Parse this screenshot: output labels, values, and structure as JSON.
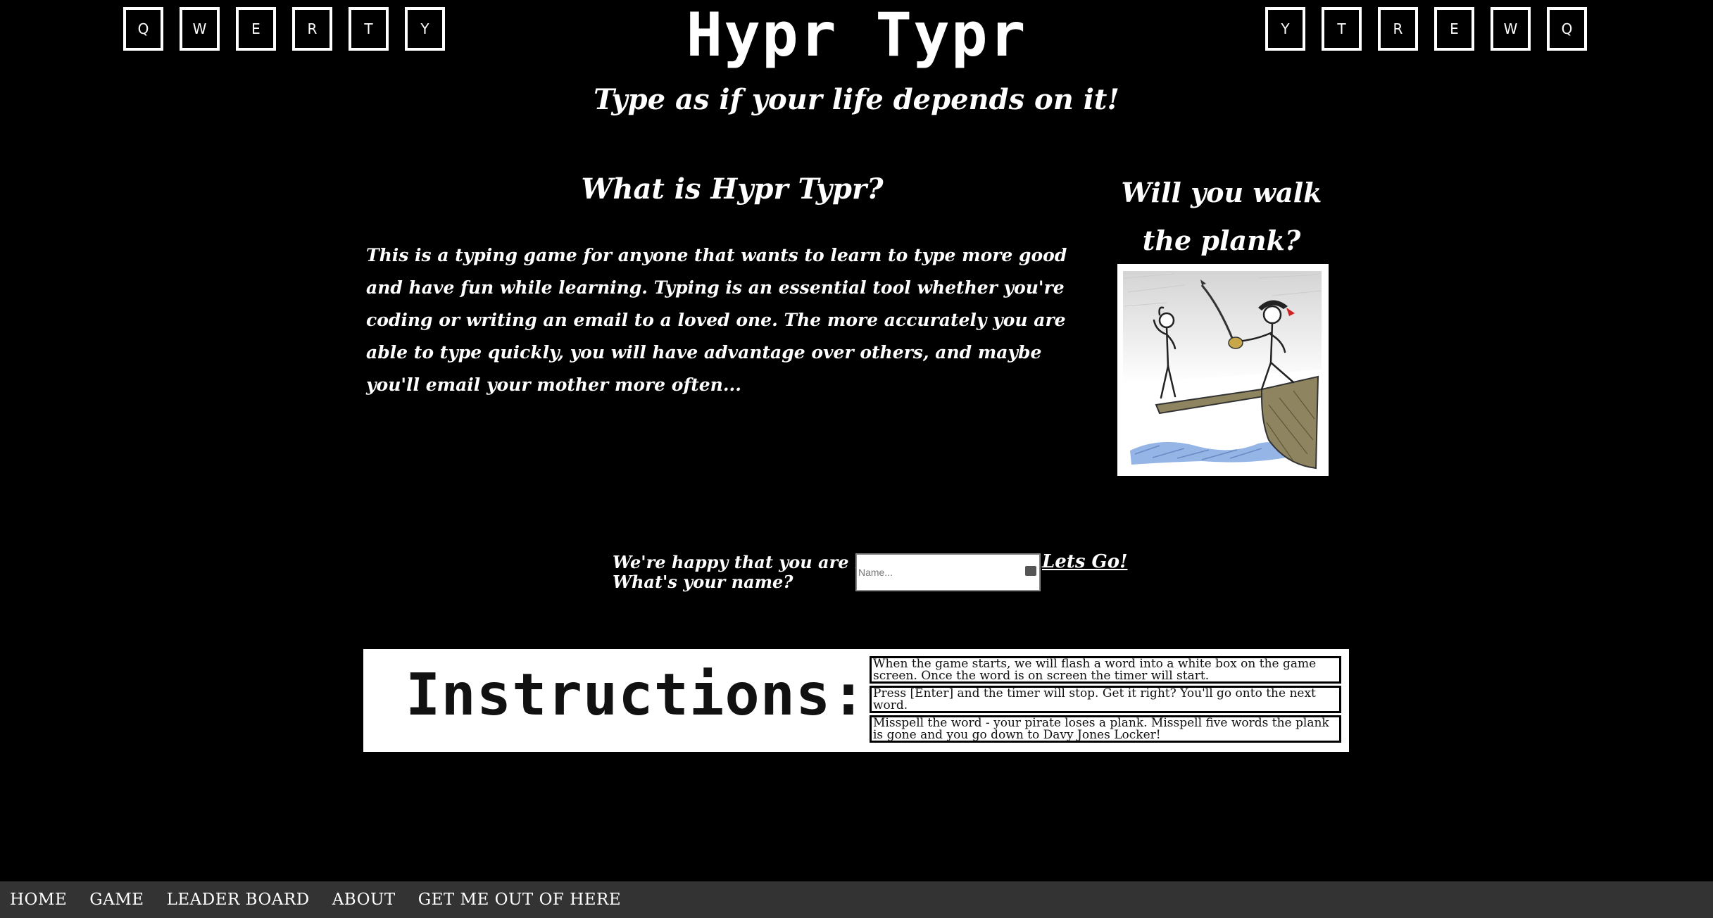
{
  "header": {
    "keys_left": [
      "Q",
      "W",
      "E",
      "R",
      "T",
      "Y"
    ],
    "keys_right": [
      "Y",
      "T",
      "R",
      "E",
      "W",
      "Q"
    ],
    "title": "Hypr Typr",
    "tagline": "Type as if your life depends on it!"
  },
  "about": {
    "heading": "What is Hypr Typr?",
    "text": "This is a typing game for anyone that wants to learn to type more good and have fun while learning. Typing is an essential tool whether you're coding or writing an email to a loved one. The more accurately you are able to type quickly, you will have advantage over others, and maybe you'll email your mother more often..."
  },
  "plank": {
    "heading": "Will you walk the plank?"
  },
  "signup": {
    "greeting_line1": "We're happy that you are here.",
    "greeting_line2": "What's your name?",
    "name_placeholder": "Name...",
    "name_value": "",
    "go_label": "Lets Go!"
  },
  "instructions": {
    "title": "Instructions:",
    "items": [
      "When the game starts, we will flash a word into a white box on the game screen. Once the word is on screen the timer will start.",
      "Press [Enter] and the timer will stop. Get it right? You'll go onto the next word.",
      "Misspell the word - your pirate loses a plank. Misspell five words the plank is gone and you go down to Davy Jones Locker!"
    ]
  },
  "nav": {
    "items": [
      "HOME",
      "GAME",
      "LEADER BOARD",
      "ABOUT",
      "GET ME OUT OF HERE"
    ]
  },
  "colors": {
    "background": "#000000",
    "text": "#ffffff",
    "nav_bar": "#333333",
    "water": "#7ba2e0",
    "plank": "#8e8560",
    "pirate_hat": "#cc2222"
  },
  "icons": {
    "input_icon": "password-manager-icon"
  }
}
